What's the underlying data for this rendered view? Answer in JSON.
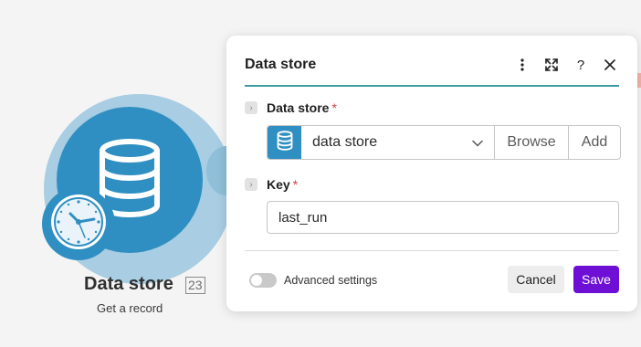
{
  "canvas": {
    "module": {
      "title": "Data store",
      "id_badge": "23",
      "subtitle": "Get a record",
      "icon": "database-icon",
      "trigger_icon": "clock-icon",
      "color": "#2f8fc2"
    }
  },
  "panel": {
    "title": "Data store",
    "header_icons": [
      "more-vertical-icon",
      "expand-icon",
      "help-icon",
      "close-icon"
    ],
    "help_label": "?",
    "fields": {
      "data_store": {
        "label": "Data store",
        "required_mark": "*",
        "value": "data store",
        "browse_label": "Browse",
        "add_label": "Add"
      },
      "key": {
        "label": "Key",
        "required_mark": "*",
        "value": "last_run"
      }
    },
    "advanced_settings_label": "Advanced settings",
    "advanced_settings_on": false,
    "cancel_label": "Cancel",
    "save_label": "Save",
    "colors": {
      "accent_line": "#3e9aa5",
      "save": "#6d0fd4",
      "required": "#d43b3b"
    }
  }
}
